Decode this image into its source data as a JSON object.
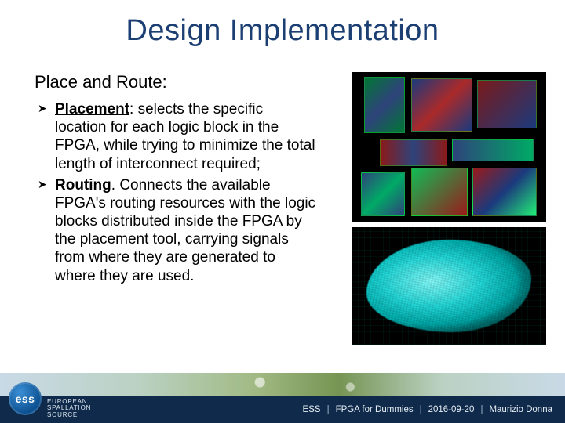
{
  "title": "Design Implementation",
  "subtitle": "Place and Route:",
  "bullets": [
    {
      "lead": "Placement",
      "text": ": selects the specific location for each logic block in the FPGA, while trying to minimize the total length of interconnect required;"
    },
    {
      "lead": "Routing",
      "text": ". Connects the available FPGA's routing resources with the logic blocks distributed inside the FPGA by the placement tool, carrying signals from where they are generated to where they are used."
    }
  ],
  "logo": {
    "short": "ess",
    "line1": "EUROPEAN",
    "line2": "SPALLATION",
    "line3": "SOURCE"
  },
  "footer": {
    "org": "ESS",
    "doc": "FPGA for Dummies",
    "date": "2016-09-20",
    "author": "Maurizio Donna",
    "sep": "|"
  },
  "images": {
    "layout_alt": "FPGA floorplan layout",
    "route_alt": "FPGA routing congestion map"
  }
}
